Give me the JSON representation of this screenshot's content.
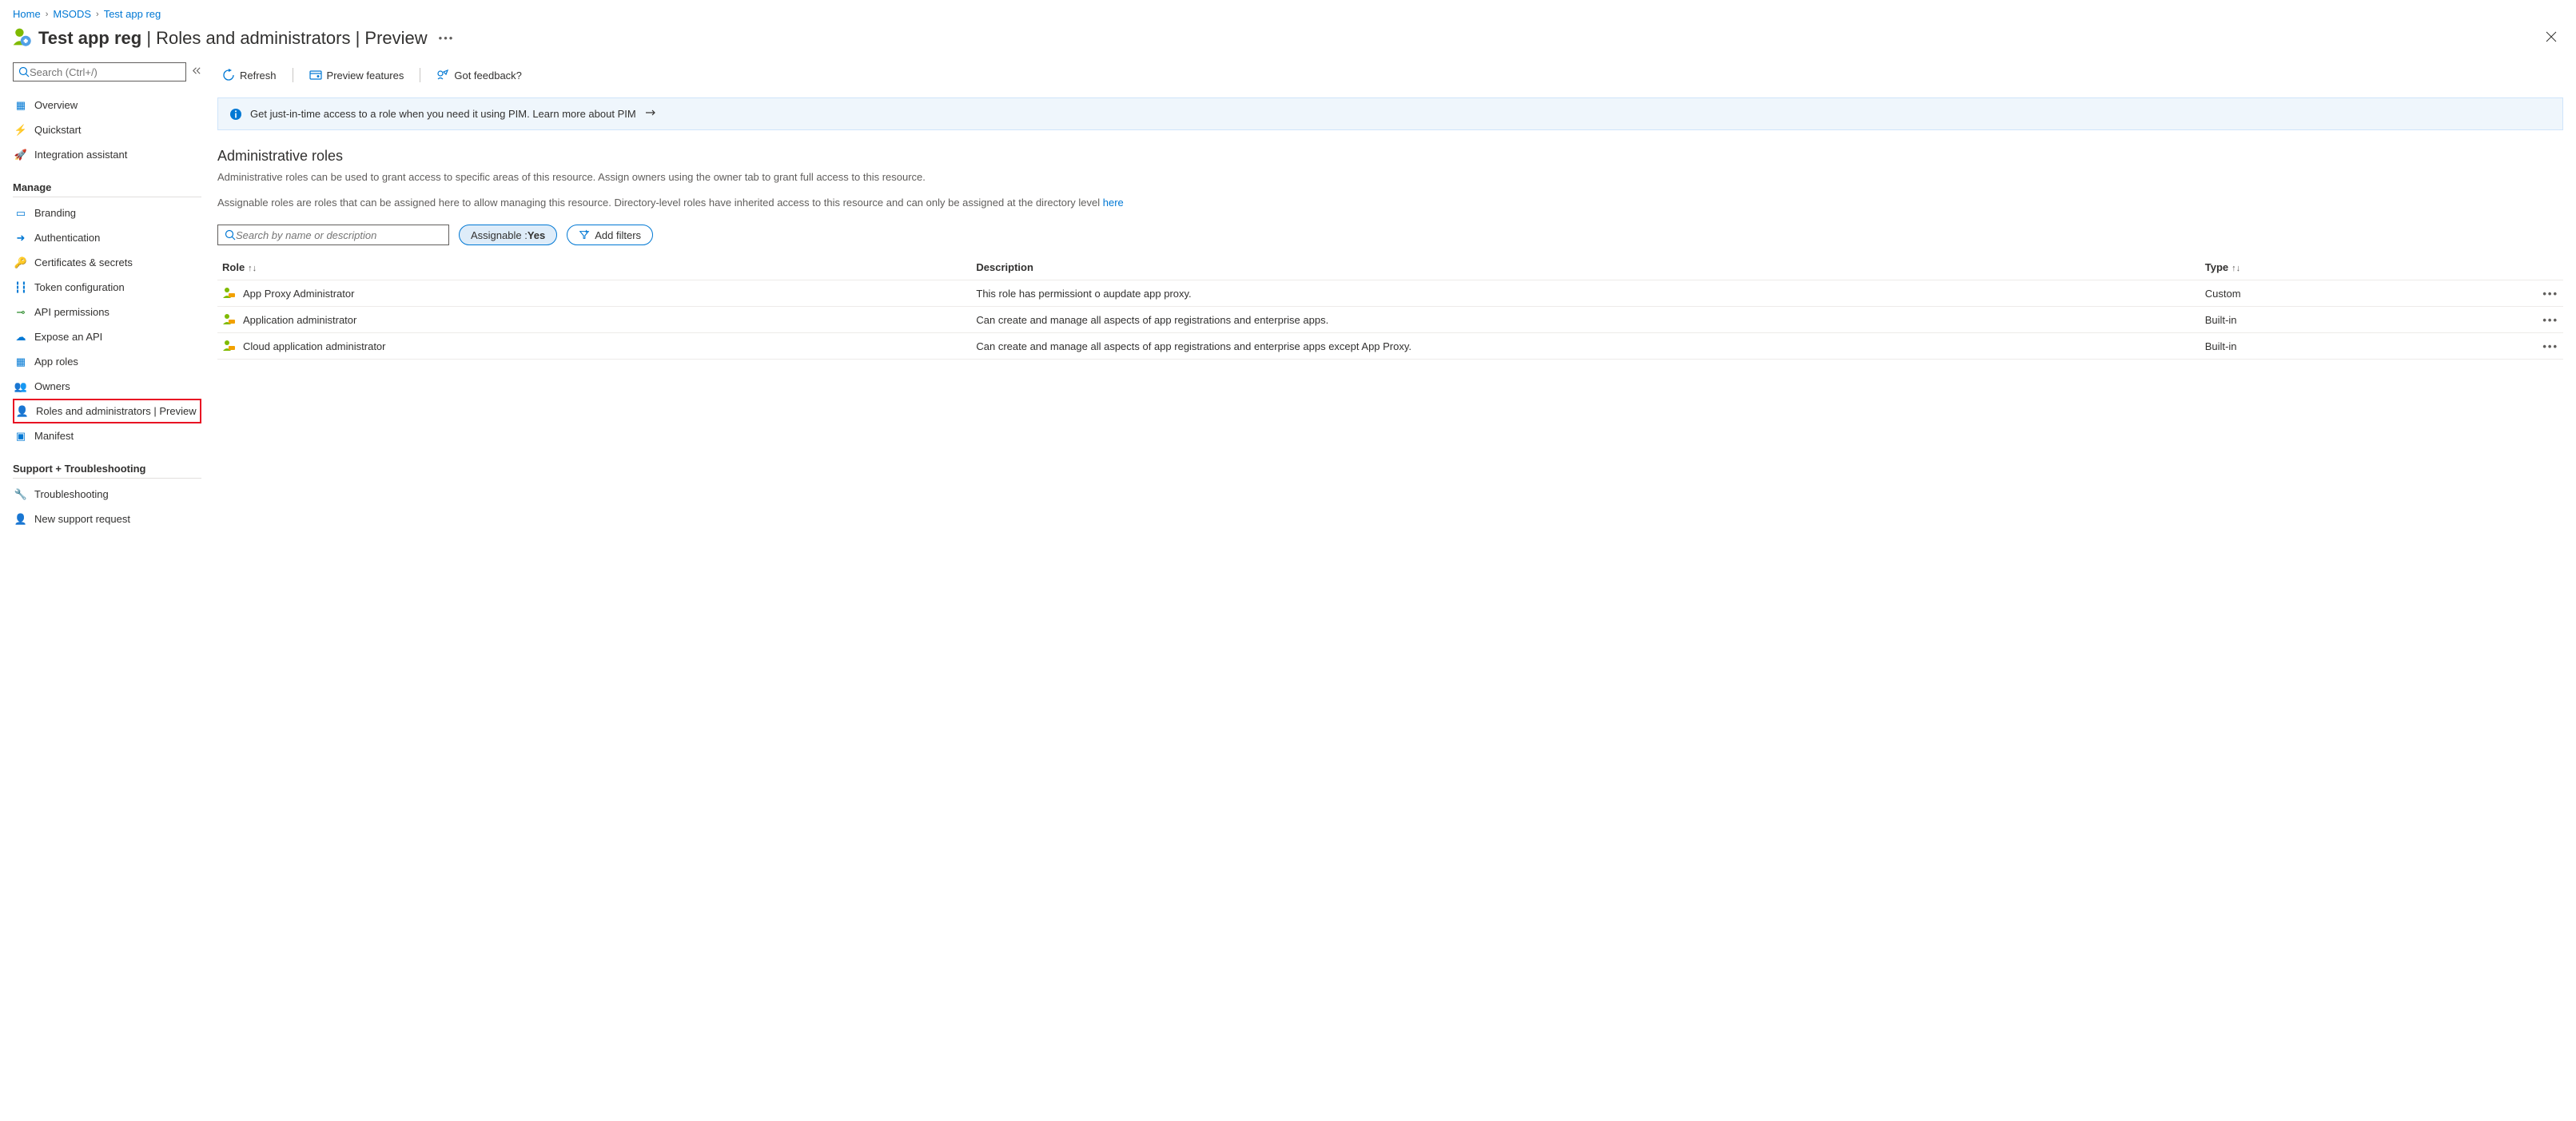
{
  "breadcrumb": {
    "home": "Home",
    "level1": "MSODS",
    "level2": "Test app reg"
  },
  "title": {
    "name": "Test app reg",
    "suffix": "| Roles and administrators | Preview"
  },
  "sidebar": {
    "search_placeholder": "Search (Ctrl+/)",
    "top": [
      {
        "label": "Overview"
      },
      {
        "label": "Quickstart"
      },
      {
        "label": "Integration assistant"
      }
    ],
    "section_manage": "Manage",
    "manage": [
      {
        "label": "Branding"
      },
      {
        "label": "Authentication"
      },
      {
        "label": "Certificates & secrets"
      },
      {
        "label": "Token configuration"
      },
      {
        "label": "API permissions"
      },
      {
        "label": "Expose an API"
      },
      {
        "label": "App roles"
      },
      {
        "label": "Owners"
      },
      {
        "label": "Roles and administrators | Preview"
      },
      {
        "label": "Manifest"
      }
    ],
    "section_support": "Support + Troubleshooting",
    "support": [
      {
        "label": "Troubleshooting"
      },
      {
        "label": "New support request"
      }
    ]
  },
  "toolbar": {
    "refresh": "Refresh",
    "preview": "Preview features",
    "feedback": "Got feedback?"
  },
  "notice": {
    "text": "Get just-in-time access to a role when you need it using PIM. Learn more about PIM"
  },
  "heading": "Administrative roles",
  "desc1": "Administrative roles can be used to grant access to specific areas of this resource. Assign owners using the owner tab to grant full access to this resource.",
  "desc2_prefix": "Assignable roles are roles that can be assigned here to allow managing this resource. Directory-level roles have inherited access to this resource and can only be assigned at the directory level ",
  "desc2_link": "here",
  "filter": {
    "search_placeholder": "Search by name or description",
    "assignable_label": "Assignable : ",
    "assignable_value": "Yes",
    "add_filters": "Add filters"
  },
  "table": {
    "col_role": "Role",
    "col_desc": "Description",
    "col_type": "Type",
    "rows": [
      {
        "name": "App Proxy Administrator",
        "desc": "This role has permissiont o aupdate app proxy.",
        "type": "Custom"
      },
      {
        "name": "Application administrator",
        "desc": "Can create and manage all aspects of app registrations and enterprise apps.",
        "type": "Built-in"
      },
      {
        "name": "Cloud application administrator",
        "desc": "Can create and manage all aspects of app registrations and enterprise apps except App Proxy.",
        "type": "Built-in"
      }
    ]
  }
}
